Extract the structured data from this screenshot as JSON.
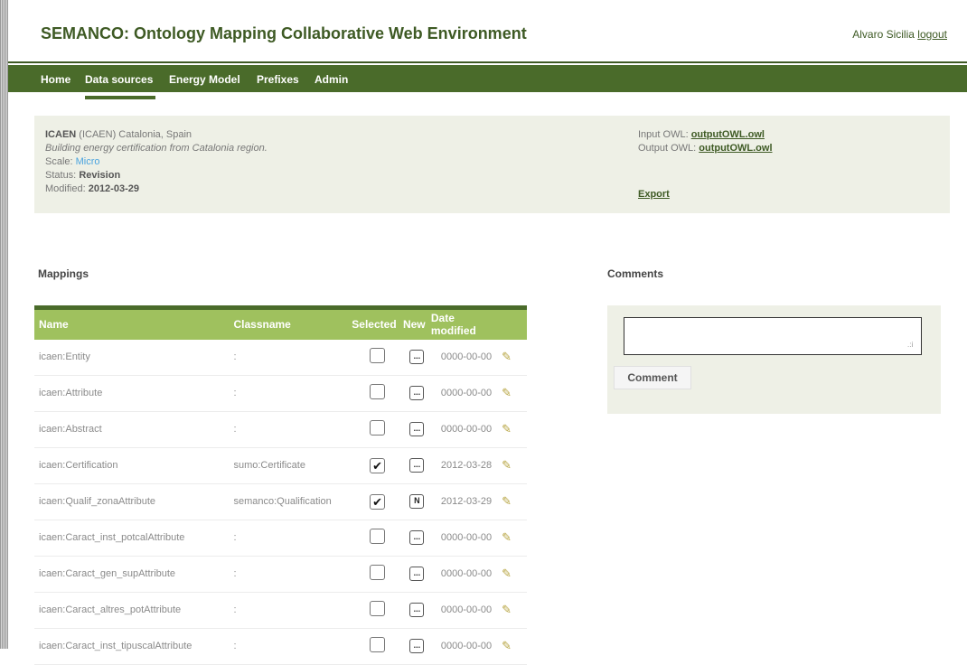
{
  "header": {
    "title": "SEMANCO: Ontology Mapping Collaborative Web Environment",
    "user_name": "Alvaro Sicilia",
    "logout_label": "logout"
  },
  "nav": {
    "items": [
      "Home",
      "Data sources",
      "Energy Model",
      "Prefixes",
      "Admin"
    ],
    "active": "Data sources"
  },
  "source": {
    "code": "ICAEN",
    "origin": "(ICAEN) Catalonia, Spain",
    "description": "Building energy certification from Catalonia region.",
    "scale_label": "Scale:",
    "scale_value": "Micro",
    "status_label": "Status:",
    "status_value": "Revision",
    "modified_label": "Modified:",
    "modified_value": "2012-03-29",
    "input_owl_label": "Input OWL:",
    "input_owl_file": "outputOWL.owl",
    "output_owl_label": "Output OWL:",
    "output_owl_file": "outputOWL.owl",
    "export_label": "Export"
  },
  "mappings": {
    "title": "Mappings",
    "columns": [
      "Name",
      "Classname",
      "Selected",
      "New",
      "Date modified"
    ],
    "rows": [
      {
        "name": "icaen:Entity",
        "classname": ":",
        "selected": false,
        "new": "...",
        "date": "0000-00-00"
      },
      {
        "name": "icaen:Attribute",
        "classname": ":",
        "selected": false,
        "new": "...",
        "date": "0000-00-00"
      },
      {
        "name": "icaen:Abstract",
        "classname": ":",
        "selected": false,
        "new": "...",
        "date": "0000-00-00"
      },
      {
        "name": "icaen:Certification",
        "classname": "sumo:Certificate",
        "selected": true,
        "new": "...",
        "date": "2012-03-28"
      },
      {
        "name": "icaen:Qualif_zonaAttribute",
        "classname": "semanco:Qualification",
        "selected": true,
        "new": "N",
        "date": "2012-03-29"
      },
      {
        "name": "icaen:Caract_inst_potcalAttribute",
        "classname": ":",
        "selected": false,
        "new": "...",
        "date": "0000-00-00"
      },
      {
        "name": "icaen:Caract_gen_supAttribute",
        "classname": ":",
        "selected": false,
        "new": "...",
        "date": "0000-00-00"
      },
      {
        "name": "icaen:Caract_altres_potAttribute",
        "classname": ":",
        "selected": false,
        "new": "...",
        "date": "0000-00-00"
      },
      {
        "name": "icaen:Caract_inst_tipuscalAttribute",
        "classname": ":",
        "selected": false,
        "new": "...",
        "date": "0000-00-00"
      }
    ]
  },
  "comments": {
    "title": "Comments",
    "input_value": "",
    "button_label": "Comment"
  },
  "colors": {
    "nav_bg": "#4a6b2a",
    "table_header": "#9fc15e",
    "panel_bg": "#eef0e6",
    "title_text": "#3e5a24",
    "scale_link": "#4aa3df"
  }
}
